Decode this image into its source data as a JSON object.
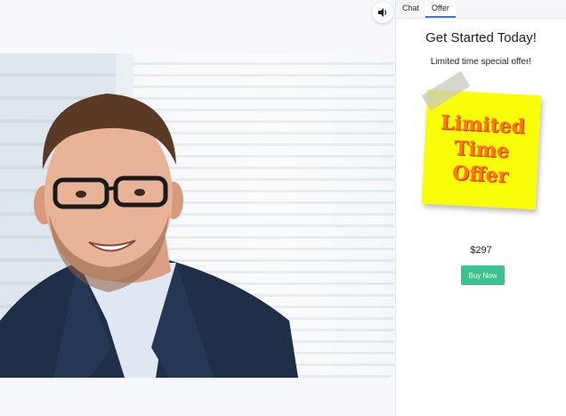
{
  "tabs": [
    {
      "label": "Chat"
    },
    {
      "label": "Offer"
    }
  ],
  "offer": {
    "title": "Get Started Today!",
    "subtitle": "Limited time special offer!",
    "sticky_lines": [
      "Limited",
      "Time",
      "Offer"
    ],
    "price": "$297",
    "buy_label": "Buy Now"
  },
  "video": {
    "speaker_icon": "speaker-icon"
  },
  "colors": {
    "accent": "#4a72d8",
    "buy_button": "#3cc290",
    "sticky_note": "#fafd08",
    "sticky_text": "#ff7a00"
  }
}
